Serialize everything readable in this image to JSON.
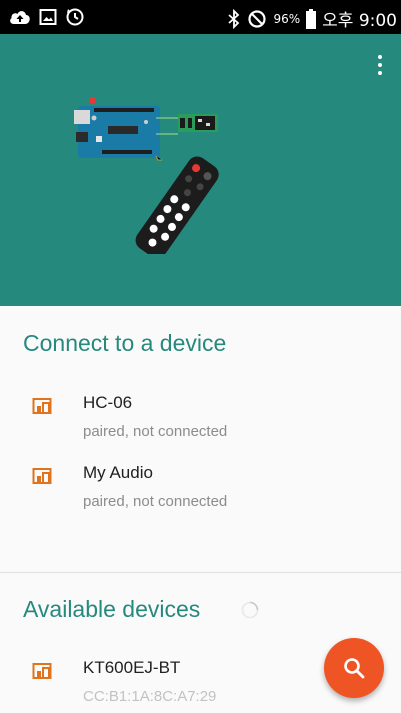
{
  "status_bar": {
    "battery_percent": "96%",
    "time": "오후 9:00",
    "icons": [
      "cloud-upload-icon",
      "gallery-icon",
      "sync-icon",
      "bluetooth-icon",
      "do-not-disturb-icon",
      "battery-icon"
    ]
  },
  "header": {
    "background_color": "#26897e",
    "overflow_icon": "more-vert-icon"
  },
  "connect_section": {
    "title": "Connect to a device",
    "devices": [
      {
        "name": "HC-06",
        "status": "paired, not connected",
        "icon": "devices-icon"
      },
      {
        "name": "My Audio",
        "status": "paired, not connected",
        "icon": "devices-icon"
      }
    ]
  },
  "available_section": {
    "title": "Available devices",
    "devices": [
      {
        "name": "KT600EJ-BT",
        "address": "CC:B1:1A:8C:A7:29",
        "icon": "devices-icon"
      }
    ]
  },
  "fab": {
    "icon": "search-icon",
    "color": "#ef5424"
  },
  "colors": {
    "accent": "#26897e",
    "device_icon": "#e0741e"
  }
}
